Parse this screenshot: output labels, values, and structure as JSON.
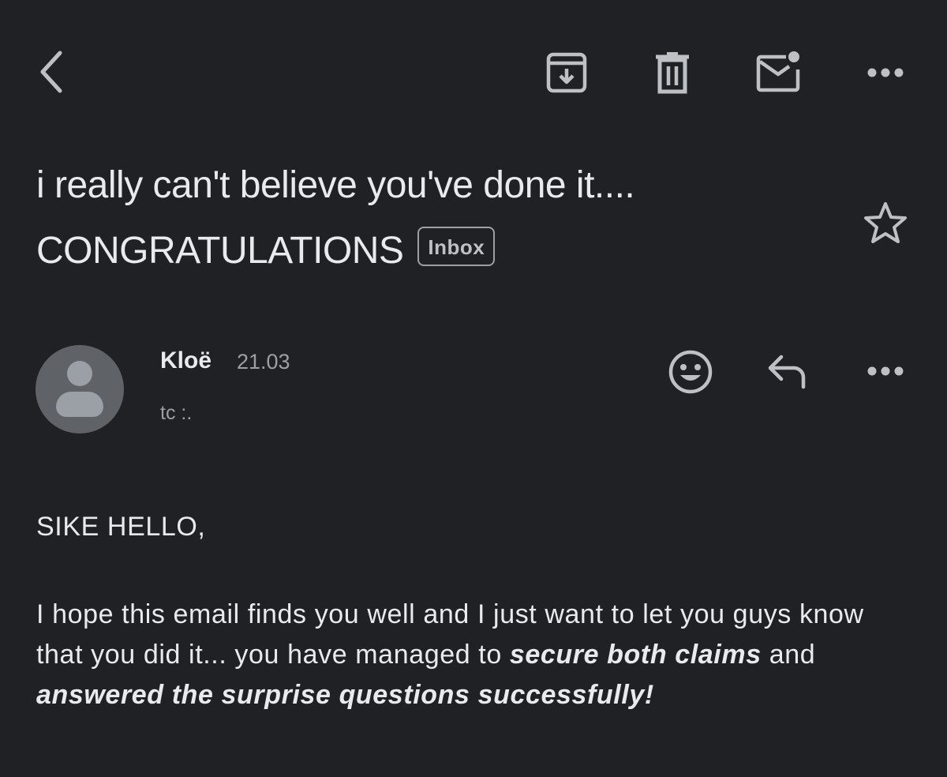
{
  "toolbar": {
    "back_icon": "chevron-left-icon",
    "archive_icon": "archive-icon",
    "delete_icon": "trash-icon",
    "unread_icon": "mark-unread-icon",
    "more_icon": "more-horizontal-icon"
  },
  "email": {
    "subject": "i really can't believe you've done it.... CONGRATULATIONS",
    "label": "Inbox",
    "star_icon": "star-outline-icon",
    "sender": {
      "name": "Kloë",
      "time": "21.03",
      "recipient": "tc :.",
      "avatar_icon": "default-avatar-icon"
    },
    "actions": {
      "emoji_icon": "emoji-react-icon",
      "reply_icon": "reply-icon",
      "more_icon": "more-horizontal-icon"
    },
    "body": {
      "greeting": "SIKE HELLO,",
      "p1": "I hope this email finds you well and I just want to let you guys know that you did it... you have managed to ",
      "p1_bold": "secure both claims",
      "p2": " and ",
      "p2_bold": "answered the surprise questions successfully!"
    }
  },
  "colors": {
    "background": "#202124",
    "text": "#e8eaed",
    "secondary_text": "#9aa0a6",
    "icon": "#bdc1c6"
  }
}
